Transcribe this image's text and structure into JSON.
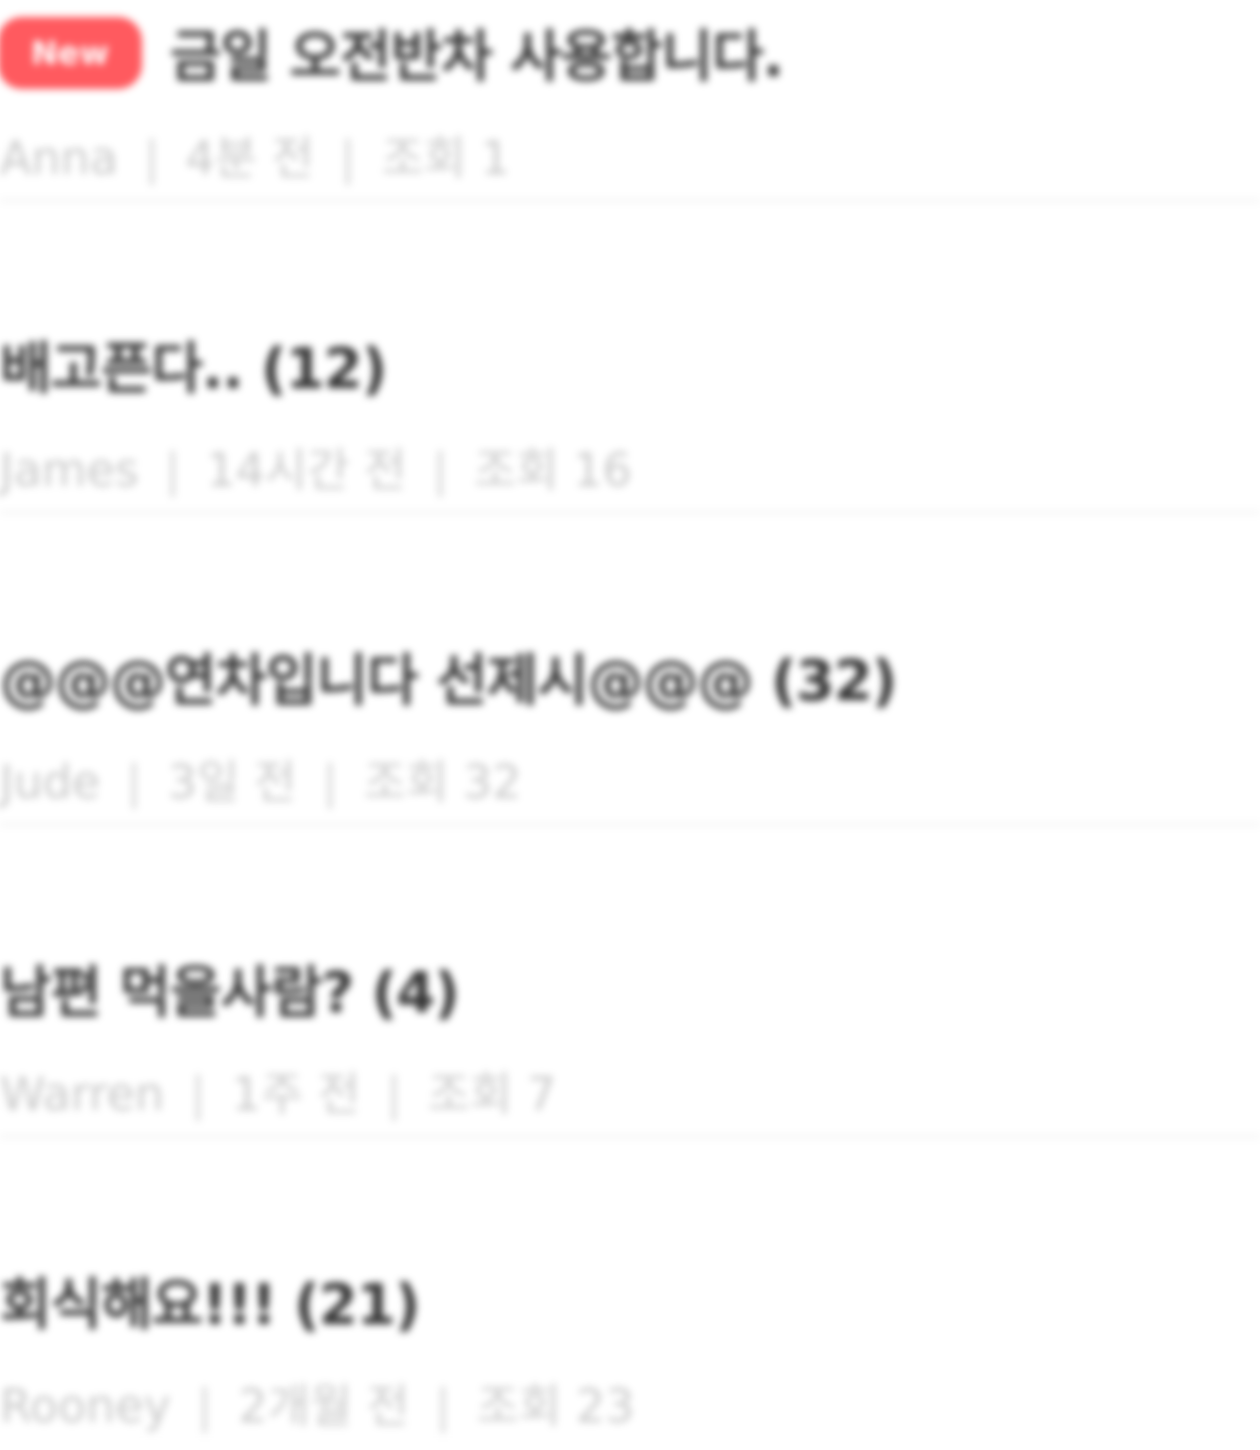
{
  "posts": [
    {
      "badge": "New",
      "title": "금일 오전반차 사용합니다.",
      "author": "Anna",
      "time": "4분 전",
      "views": "조회 1",
      "separator": "|"
    },
    {
      "badge": "",
      "title": "배고픈다.. (12)",
      "author": "James",
      "time": "14시간 전",
      "views": "조회 16",
      "separator": "|"
    },
    {
      "badge": "",
      "title": "@@@연차입니다 선제시@@@ (32)",
      "author": "Jude",
      "time": "3일 전",
      "views": "조회 32",
      "separator": "|"
    },
    {
      "badge": "",
      "title": "남편 먹을사람? (4)",
      "author": "Warren",
      "time": "1주 전",
      "views": "조회 7",
      "separator": "|"
    },
    {
      "badge": "",
      "title": "회식해요!!! (21)",
      "author": "Rooney",
      "time": "2개월 전",
      "views": "조회 23",
      "separator": "|"
    }
  ],
  "colors": {
    "badge_bg": "#ff5a5f",
    "title": "#333333",
    "meta": "#c9c9c9",
    "divider": "#f1f1f1"
  }
}
